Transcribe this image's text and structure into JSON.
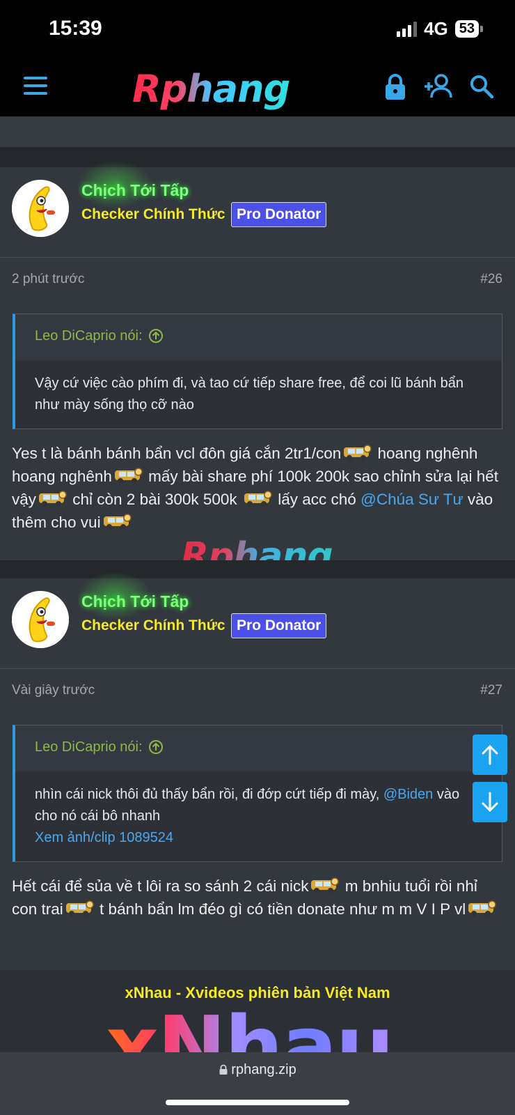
{
  "status_bar": {
    "time": "15:39",
    "network": "4G",
    "battery": "53"
  },
  "header": {
    "logo_text": "Rphang",
    "icons": [
      "menu-icon",
      "lock-icon",
      "add-user-icon",
      "search-icon"
    ]
  },
  "posts": [
    {
      "author": "Chịch Tới Tấp",
      "user_title": "Checker Chính Thức",
      "badge": "Pro Donator",
      "time": "2 phút trước",
      "number": "#26",
      "quote_author": "Leo DiCaprio nói:",
      "quote_text": "Vậy cứ việc cào phím đi, và tao cứ tiếp share free, để coi lũ bánh bẩn như mày sống thọ cỡ nào",
      "text_parts": [
        "Yes t là bánh bánh bẩn vcl đôn giá cắn 2tr1/con",
        " hoang nghênh hoang nghênh",
        " mấy bài share phí 100k 200k sao chỉnh sửa lại hết vậy",
        " chỉ còn 2 bài 300k 500k ",
        " lấy acc chó ",
        " vào thêm cho vui"
      ],
      "mention": "@Chúa Sư Tư"
    },
    {
      "author": "Chịch Tới Tấp",
      "user_title": "Checker Chính Thức",
      "badge": "Pro Donator",
      "time": "Vài giây trước",
      "number": "#27",
      "quote_author": "Leo DiCaprio nói:",
      "quote_text_before": "nhìn cái nick thôi đủ thấy bẩn rồi, đi đớp cứt tiếp đi mày, ",
      "quote_mention": "@Biden",
      "quote_text_after": " vào cho nó cái bô nhanh",
      "quote_link": "Xem ảnh/clip 1089524",
      "text_parts": [
        "Hết cái để sủa về t lôi ra so sánh 2 cái nick",
        " m bnhiu tuổi rồi nhỉ con trai",
        " t bánh bẩn lm đéo gì có tiền donate như m m V I P vl"
      ]
    }
  ],
  "watermark": "Rphang",
  "ad": {
    "title": "xNhau - Xvideos phiên bản Việt Nam",
    "logo_text": "xNhau"
  },
  "url_bar": {
    "url": "rphang.zip"
  },
  "colors": {
    "accent": "#1aa3f0",
    "author": "#7dff7d",
    "user_title": "#f4ea26",
    "badge": "#4b50e6",
    "quote_author": "#8fb84a"
  }
}
